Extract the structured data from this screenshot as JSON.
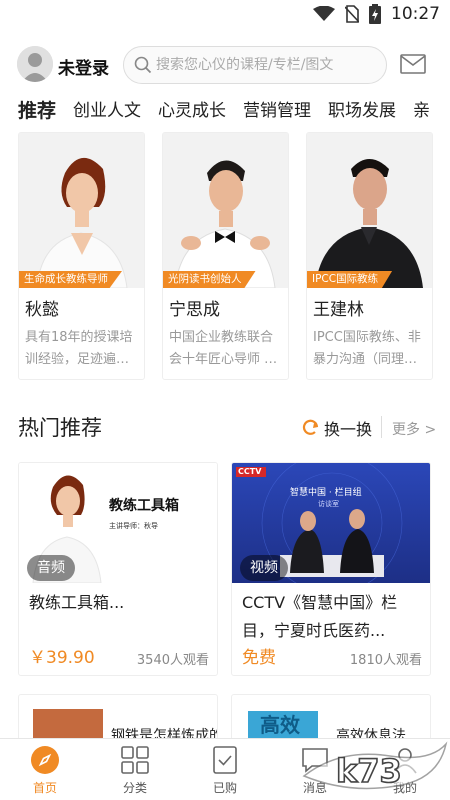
{
  "status": {
    "time": "10:27"
  },
  "header": {
    "login_label": "未登录",
    "search_placeholder": "搜索您心仪的课程/专栏/图文"
  },
  "tabs": [
    "推荐",
    "创业人文",
    "心灵成长",
    "营销管理",
    "职场发展",
    "亲"
  ],
  "teachers": [
    {
      "badge": "生命成长教练导师",
      "name": "秋懿",
      "desc": "具有18年的授课培训经验，足迹遍…"
    },
    {
      "badge": "光阴读书创始人",
      "name": "宁思成",
      "desc": "中国企业教练联合会十年匠心导师 …"
    },
    {
      "badge": "IPCC国际教练",
      "name": "王建林",
      "desc": "IPCC国际教练、非暴力沟通（同理…"
    }
  ],
  "hot": {
    "title": "热门推荐",
    "refresh_label": "换一换",
    "more_label": "更多 >"
  },
  "courses": [
    {
      "thumb_title": "教练工具箱",
      "thumb_sub": "主讲导师：秋导",
      "tag": "音频",
      "title": "教练工具箱...",
      "price": "￥39.90",
      "views": "3540人观看"
    },
    {
      "thumb_banner": "智慧中国 · 栏目组",
      "thumb_sub": "访谈室",
      "thumb_logo": "CCTV",
      "tag": "视频",
      "title": "CCTV《智慧中国》栏目，宁夏时氏医药...",
      "price": "免费",
      "views": "1810人观看"
    }
  ],
  "partial_courses": [
    {
      "title": "钢铁是怎样炼成的"
    },
    {
      "thumb_text": "高效",
      "title": "高效休息法"
    }
  ],
  "nav": [
    {
      "label": "首页",
      "icon": "compass-icon",
      "active": true
    },
    {
      "label": "分类",
      "icon": "grid-icon",
      "active": false
    },
    {
      "label": "已购",
      "icon": "purchased-icon",
      "active": false
    },
    {
      "label": "消息",
      "icon": "message-icon",
      "active": false
    },
    {
      "label": "我的",
      "icon": "profile-icon",
      "active": false
    }
  ],
  "watermark": {
    "text": "k73"
  },
  "colors": {
    "accent": "#f08a24",
    "muted": "#999999"
  }
}
